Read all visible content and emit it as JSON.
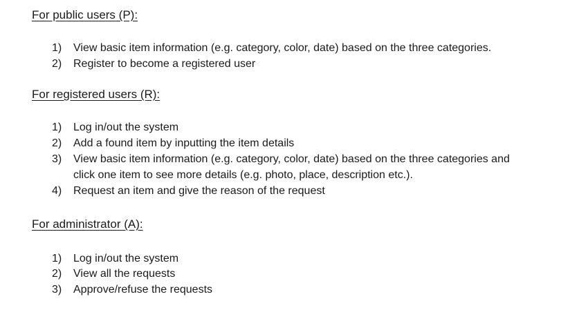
{
  "sections": [
    {
      "heading": "For public users (P):",
      "items": [
        {
          "num": "1)",
          "text": "View basic item information (e.g. category, color, date) based on the three categories."
        },
        {
          "num": "2)",
          "text": "Register to become a registered user"
        }
      ]
    },
    {
      "heading": "For registered users (R):",
      "items": [
        {
          "num": "1)",
          "text": "Log in/out the system"
        },
        {
          "num": "2)",
          "text": "Add a found item by inputting the item details"
        },
        {
          "num": "3)",
          "text": "View basic item information (e.g. category, color, date) based on the three categories and",
          "continuation": "click one item to see more details (e.g. photo, place, description etc.)."
        },
        {
          "num": "4)",
          "text": "Request an item and give the reason of the request"
        }
      ]
    },
    {
      "heading": "For administrator (A):",
      "items": [
        {
          "num": "1)",
          "text": "Log in/out the system"
        },
        {
          "num": "2)",
          "text": "View all the requests"
        },
        {
          "num": "3)",
          "text": "Approve/refuse the requests"
        }
      ]
    }
  ]
}
